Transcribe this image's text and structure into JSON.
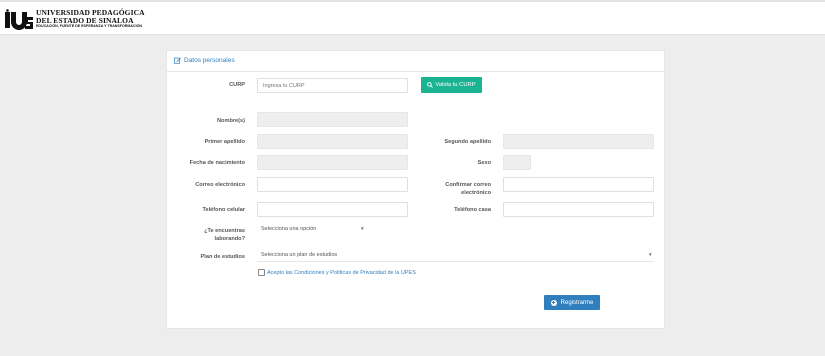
{
  "header": {
    "logo_line1": "UNIVERSIDAD PEDAGÓGICA",
    "logo_line2": "DEL ESTADO DE SINALOA",
    "logo_line3": "EDUCACIÓN, FUENTE DE ESPERANZA Y TRANSFORMACIÓN",
    "logo_mark_text": "UPES"
  },
  "card": {
    "title": "Datos personales",
    "title_icon": "edit-icon"
  },
  "form": {
    "curp_label": "CURP",
    "curp_placeholder": "Ingresa tu CURP",
    "validate_button": "Valida tu CURP",
    "nombre_label": "Nombre(s)",
    "primer_apellido_label": "Primer apellido",
    "segundo_apellido_label": "Segundo apellido",
    "fecha_nacimiento_label": "Fecha de nacimiento",
    "sexo_label": "Sexo",
    "correo_label": "Correo electrónico",
    "confirmar_correo_label": "Confirmar correo electrónico",
    "telefono_celular_label": "Teléfono celular",
    "telefono_casa_label": "Teléfono casa",
    "trabajando_label": "¿Te encuentras laborando?",
    "trabajando_value": "Selecciona una opción",
    "plan_label": "Plan de estudios",
    "plan_value": "Selecciona un plan de estudios",
    "terms_text": "Acepto las Condiciones y Políticas de Privacidad de la UPES",
    "submit_button": "Registrarme"
  },
  "colors": {
    "teal_button": "#1ab394",
    "blue_button": "#2f7fbf",
    "link": "#2f7fbf"
  }
}
